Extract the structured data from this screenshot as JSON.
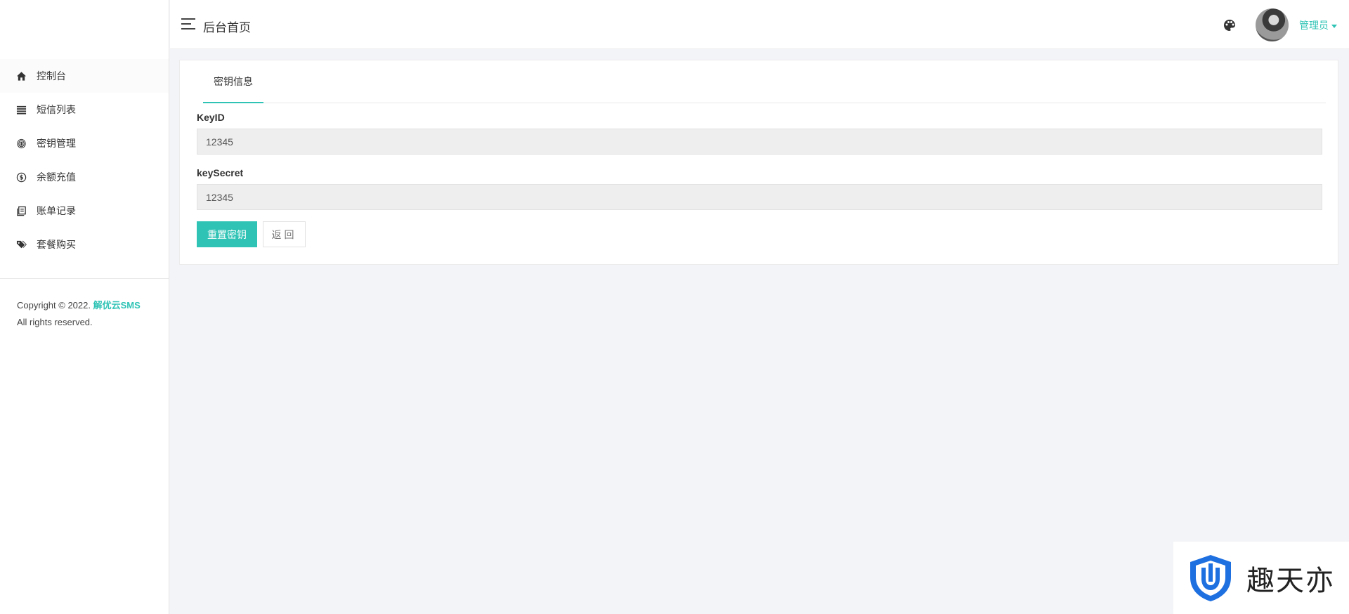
{
  "header": {
    "title": "后台首页",
    "user_name": "管理员"
  },
  "sidebar": {
    "items": [
      {
        "label": "控制台",
        "icon": "home-icon"
      },
      {
        "label": "短信列表",
        "icon": "list-icon"
      },
      {
        "label": "密钥管理",
        "icon": "fingerprint-icon"
      },
      {
        "label": "余额充值",
        "icon": "dollar-circle-icon"
      },
      {
        "label": "账单记录",
        "icon": "book-icon"
      },
      {
        "label": "套餐购买",
        "icon": "tags-icon"
      }
    ],
    "copyright_prefix": "Copyright © 2022.",
    "copyright_brand": "解优云SMS",
    "copyright_suffix": "All rights reserved."
  },
  "main": {
    "tab_label": "密钥信息",
    "fields": [
      {
        "label": "KeyID",
        "value": "12345"
      },
      {
        "label": "keySecret",
        "value": "12345"
      }
    ],
    "reset_button": "重置密钥",
    "back_button": "返回"
  },
  "watermark": {
    "text": "趣天亦"
  },
  "colors": {
    "accent": "#2fc3b5",
    "background": "#f3f4f8"
  }
}
